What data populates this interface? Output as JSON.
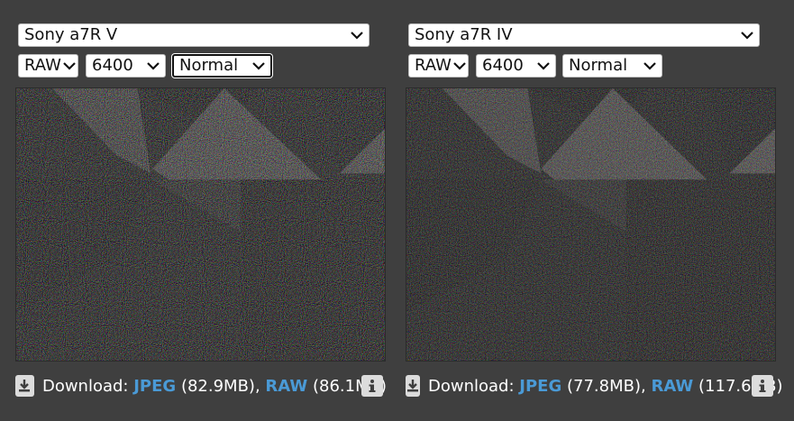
{
  "left": {
    "camera": "Sony a7R V",
    "format": "RAW",
    "iso": "6400",
    "mode": "Normal",
    "download": {
      "label": "Download:",
      "jpeg_label": "JPEG",
      "jpeg_size": "(82.9MB),",
      "raw_label": "RAW",
      "raw_size": "(86.1MB)"
    }
  },
  "right": {
    "camera": "Sony a7R IV",
    "format": "RAW",
    "iso": "6400",
    "mode": "Normal",
    "download": {
      "label": "Download:",
      "jpeg_label": "JPEG",
      "jpeg_size": "(77.8MB),",
      "raw_label": "RAW",
      "raw_size": "(117.6MB)"
    }
  },
  "icons": {
    "download": "download-icon",
    "info": "info-icon",
    "chevron": "chevron-down-icon"
  },
  "colors": {
    "background": "#3f3f3f",
    "link": "#4a9ad6",
    "icon_bg": "#dcdcdc"
  }
}
